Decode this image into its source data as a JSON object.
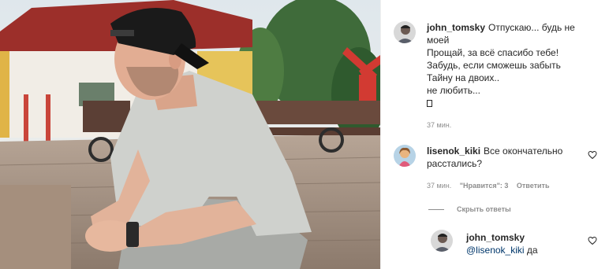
{
  "post": {
    "image": {
      "kind": "photo"
    }
  },
  "comments": [
    {
      "username": "john_tomsky",
      "lines": [
        "Отпускаю... будь не",
        "моей",
        "Прощай, за всё спасибо тебе!",
        "Забудь, если сможешь забыть",
        "Тайну на двоих..",
        "не любить..."
      ],
      "time": "37 мин."
    },
    {
      "username": "lisenok_kiki",
      "text_line1": "Все окончательно",
      "text_line2": "расстались?",
      "time": "37 мин.",
      "likes": "\"Нравится\": 3",
      "reply_label": "Ответить"
    }
  ],
  "hide_replies_label": "Скрыть ответы",
  "reply": {
    "username": "john_tomsky",
    "mention": "@lisenok_kiki",
    "text": "да"
  },
  "colors": {
    "text": "#262626",
    "meta": "#8e8e8e",
    "mention": "#00376b"
  },
  "icons": [
    "heart-icon",
    "avatar"
  ]
}
